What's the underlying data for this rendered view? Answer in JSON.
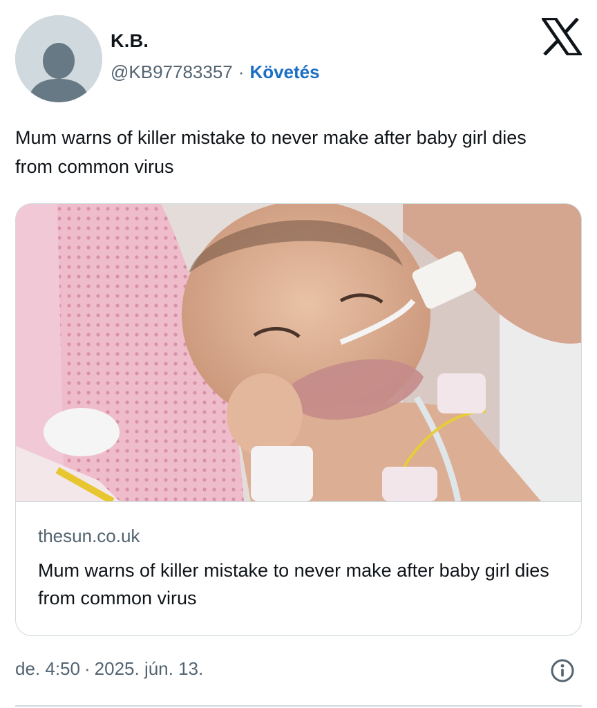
{
  "author": {
    "display_name": "K.B.",
    "handle": "@KB97783357",
    "separator": "·",
    "follow_label": "Követés",
    "avatar_icon": "default-user-avatar-icon"
  },
  "brand": {
    "logo_icon": "x-logo-icon"
  },
  "tweet": {
    "text": "Mum warns of killer mistake to never make after baby girl dies from common virus"
  },
  "card": {
    "image_icon": "news-photo-baby-in-hospital",
    "domain": "thesun.co.uk",
    "title": "Mum warns of killer mistake to never make after baby girl dies from common virus"
  },
  "meta": {
    "time": "de. 4:50",
    "separator": "·",
    "date": "2025. jún. 13.",
    "info_icon": "info-icon"
  },
  "colors": {
    "link": "#1d6fc4",
    "secondary_text": "#536471",
    "border": "#cfd9de"
  }
}
